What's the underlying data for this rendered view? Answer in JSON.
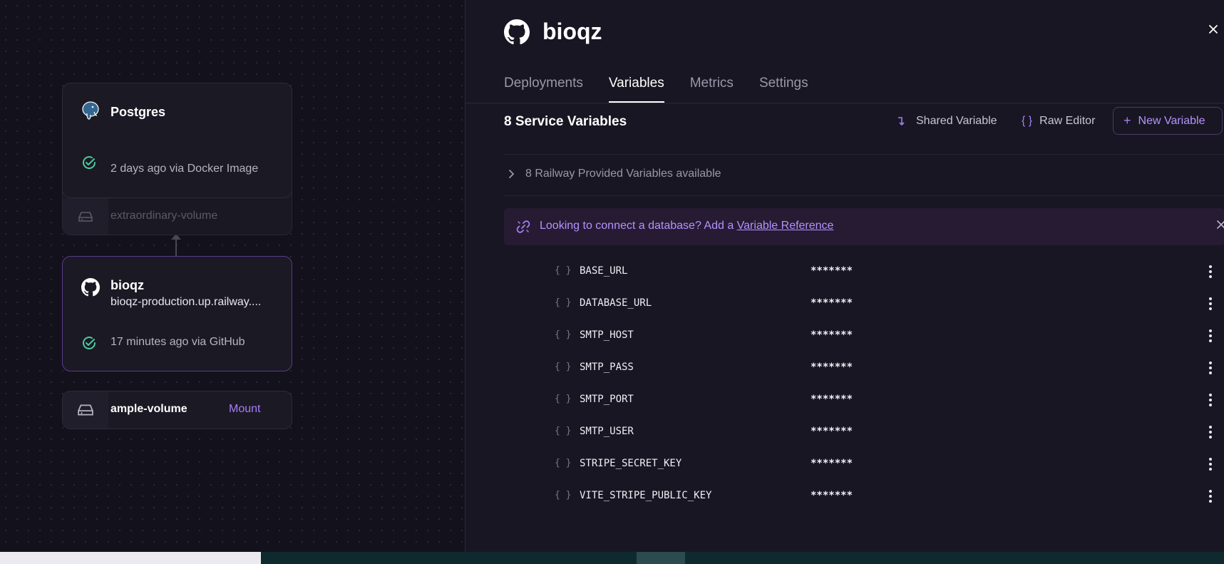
{
  "canvas": {
    "postgres_card": {
      "title": "Postgres",
      "status": "2 days ago via Docker Image",
      "volume": "extraordinary-volume"
    },
    "service_card": {
      "title": "bioqz",
      "url": "bioqz-production.up.railway....",
      "status": "17 minutes ago via GitHub"
    },
    "volume_card": {
      "name": "ample-volume",
      "action": "Mount"
    }
  },
  "panel": {
    "title": "bioqz",
    "tabs": [
      {
        "label": "Deployments"
      },
      {
        "label": "Variables"
      },
      {
        "label": "Metrics"
      },
      {
        "label": "Settings"
      }
    ],
    "active_tab": "Variables",
    "section_title": "8 Service Variables",
    "actions": {
      "shared": "Shared Variable",
      "raw": "Raw Editor",
      "new": "New Variable"
    },
    "provided": "8 Railway Provided Variables available",
    "banner": {
      "text": "Looking to connect a database? Add a",
      "link": "Variable Reference"
    },
    "variables": [
      {
        "name": "BASE_URL",
        "value": "*******"
      },
      {
        "name": "DATABASE_URL",
        "value": "*******"
      },
      {
        "name": "SMTP_HOST",
        "value": "*******"
      },
      {
        "name": "SMTP_PASS",
        "value": "*******"
      },
      {
        "name": "SMTP_PORT",
        "value": "*******"
      },
      {
        "name": "SMTP_USER",
        "value": "*******"
      },
      {
        "name": "STRIPE_SECRET_KEY",
        "value": "*******"
      },
      {
        "name": "VITE_STRIPE_PUBLIC_KEY",
        "value": "*******"
      }
    ]
  },
  "colors": {
    "accent": "#a77dfc",
    "success": "#4ecb9e",
    "background": "#13111c"
  }
}
